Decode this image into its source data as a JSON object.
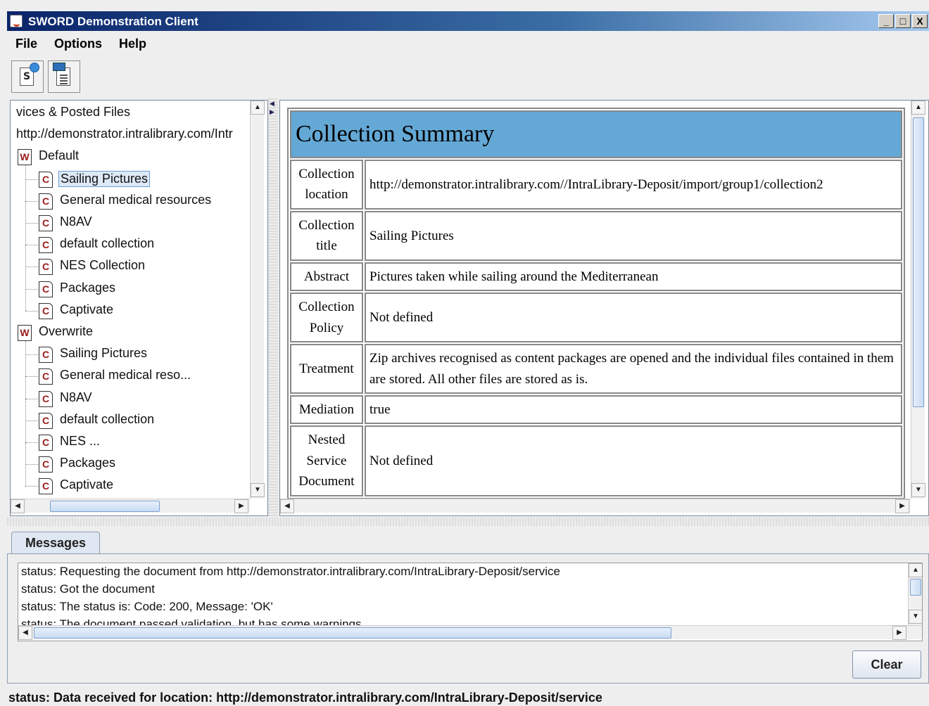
{
  "window": {
    "title": "SWORD Demonstration Client",
    "controls": {
      "minimize": "_",
      "maximize": "□",
      "close": "X"
    }
  },
  "menu": [
    "File",
    "Options",
    "Help"
  ],
  "toolbar": {
    "buttons": [
      {
        "name": "service-document-button",
        "icon": "S"
      },
      {
        "name": "post-file-button",
        "icon": "document-icon"
      }
    ]
  },
  "tree": {
    "header": "vices & Posted Files",
    "root": "http://demonstrator.intralibrary.com/Intr",
    "workspaces": [
      {
        "icon": "W",
        "label": "Default",
        "collections": [
          "Sailing Pictures",
          "General medical resources",
          "N8AV",
          "default collection",
          "NES Collection",
          "Packages",
          "Captivate"
        ]
      },
      {
        "icon": "W",
        "label": "Overwrite",
        "collections": [
          "Sailing Pictures",
          "General medical reso...",
          "N8AV",
          "default collection",
          "NES ...",
          "Packages",
          "Captivate"
        ]
      }
    ],
    "collection_icon": "C",
    "selected": "Sailing Pictures"
  },
  "summary": {
    "title": "Collection Summary",
    "rows": [
      {
        "key": "Collection location",
        "value": "http://demonstrator.intralibrary.com//IntraLibrary-Deposit/import/group1/collection2"
      },
      {
        "key": "Collection title",
        "value": "Sailing Pictures"
      },
      {
        "key": "Abstract",
        "value": "Pictures taken while sailing around the Mediterranean"
      },
      {
        "key": "Collection Policy",
        "value": "Not defined"
      },
      {
        "key": "Treatment",
        "value": "Zip archives recognised as content packages are opened and the individual files contained in them are stored. All other files are stored as is."
      },
      {
        "key": "Mediation",
        "value": "true"
      },
      {
        "key": "Nested Service Document",
        "value": "Not defined"
      }
    ]
  },
  "messages": {
    "tab": "Messages",
    "lines": [
      "status: Requesting the document from http://demonstrator.intralibrary.com/IntraLibrary-Deposit/service",
      "status: Got the document",
      "status: The status is: Code: 200, Message: 'OK'",
      "status: The document passed validation, but has some warnings"
    ],
    "clear_label": "Clear"
  },
  "status": "status: Data received for location: http://demonstrator.intralibrary.com/IntraLibrary-Deposit/service",
  "colors": {
    "title_bar": "#0a246a",
    "summary_header": "#64a8d6",
    "selection": "#dde9f6"
  }
}
